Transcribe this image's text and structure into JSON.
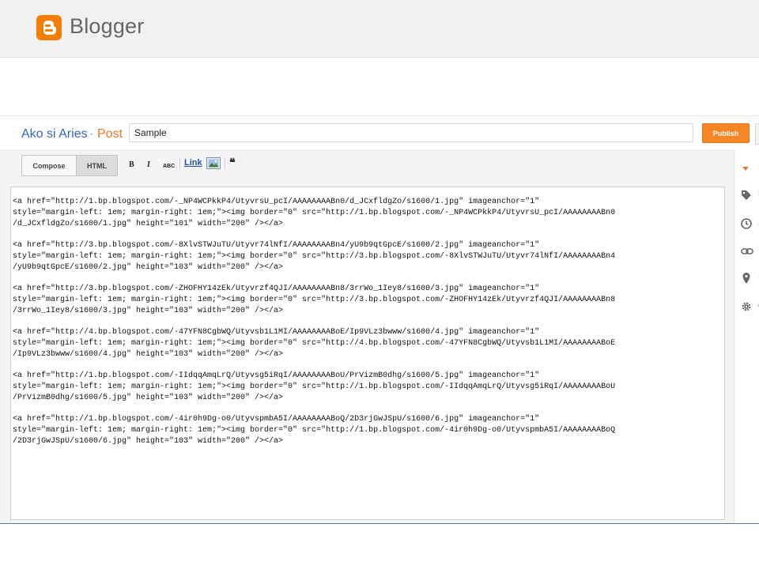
{
  "brand": {
    "name": "Blogger",
    "accent": "#f57d00"
  },
  "post_header": {
    "blog_name": "Ako si Aries",
    "separator": "·",
    "crumb": "Post",
    "title_value": "Sample",
    "publish_label": "Publish"
  },
  "toolbar": {
    "compose_label": "Compose",
    "html_label": "HTML",
    "bold": "B",
    "italic": "I",
    "strike": "ABC",
    "link_label": "Link",
    "quote": "❝"
  },
  "editor": {
    "blocks": [
      "<a href=\"http://1.bp.blogspot.com/-_NP4WCPkkP4/UtyvrsU_pcI/AAAAAAAABn0/d_JCxfldgZo/s1600/1.jpg\" imageanchor=\"1\"\nstyle=\"margin-left: 1em; margin-right: 1em;\"><img border=\"0\" src=\"http://1.bp.blogspot.com/-_NP4WCPkkP4/UtyvrsU_pcI/AAAAAAAABn0\n/d_JCxfldgZo/s1600/1.jpg\" height=\"101\" width=\"200\" /></a>",
      "<a href=\"http://3.bp.blogspot.com/-8XlvSTWJuTU/Utyvr74lNfI/AAAAAAAABn4/yU9b9qtGpcE/s1600/2.jpg\" imageanchor=\"1\"\nstyle=\"margin-left: 1em; margin-right: 1em;\"><img border=\"0\" src=\"http://3.bp.blogspot.com/-8XlvSTWJuTU/Utyvr74lNfI/AAAAAAAABn4\n/yU9b9qtGpcE/s1600/2.jpg\" height=\"103\" width=\"200\" /></a>",
      "<a href=\"http://3.bp.blogspot.com/-ZHOFHY14zEk/Utyvrzf4QJI/AAAAAAAABn8/3rrWo_1Iey8/s1600/3.jpg\" imageanchor=\"1\"\nstyle=\"margin-left: 1em; margin-right: 1em;\"><img border=\"0\" src=\"http://3.bp.blogspot.com/-ZHOFHY14zEk/Utyvrzf4QJI/AAAAAAAABn8\n/3rrWo_1Iey8/s1600/3.jpg\" height=\"103\" width=\"200\" /></a>",
      "<a href=\"http://4.bp.blogspot.com/-47YFN8CgbWQ/Utyvsb1L1MI/AAAAAAAABoE/Ip9VLz3bwww/s1600/4.jpg\" imageanchor=\"1\"\nstyle=\"margin-left: 1em; margin-right: 1em;\"><img border=\"0\" src=\"http://4.bp.blogspot.com/-47YFN8CgbWQ/Utyvsb1L1MI/AAAAAAAABoE\n/Ip9VLz3bwww/s1600/4.jpg\" height=\"103\" width=\"200\" /></a>",
      "<a href=\"http://1.bp.blogspot.com/-IIdqqAmqLrQ/Utyvsg5iRqI/AAAAAAAABoU/PrVizmB0dhg/s1600/5.jpg\" imageanchor=\"1\"\nstyle=\"margin-left: 1em; margin-right: 1em;\"><img border=\"0\" src=\"http://1.bp.blogspot.com/-IIdqqAmqLrQ/Utyvsg5iRqI/AAAAAAAABoU\n/PrVizmB0dhg/s1600/5.jpg\" height=\"103\" width=\"200\" /></a>",
      "<a href=\"http://1.bp.blogspot.com/-4ir0h9Dg-o0/UtyvspmbA5I/AAAAAAAABoQ/2D3rjGwJSpU/s1600/6.jpg\" imageanchor=\"1\"\nstyle=\"margin-left: 1em; margin-right: 1em;\"><img border=\"0\" src=\"http://1.bp.blogspot.com/-4ir0h9Dg-o0/UtyvspmbA5I/AAAAAAAABoQ\n/2D3rjGwJSpU/s1600/6.jpg\" height=\"103\" width=\"200\" /></a>"
    ]
  },
  "sidebar": {
    "items": [
      {
        "icon": "caret-down-icon",
        "label": "P"
      },
      {
        "icon": "tag-icon",
        "label": "L"
      },
      {
        "icon": "clock-icon",
        "label": "S"
      },
      {
        "icon": "link-icon",
        "label": ""
      },
      {
        "icon": "location-pin-icon",
        "label": "L"
      },
      {
        "icon": "gear-icon",
        "label": "O"
      }
    ]
  }
}
